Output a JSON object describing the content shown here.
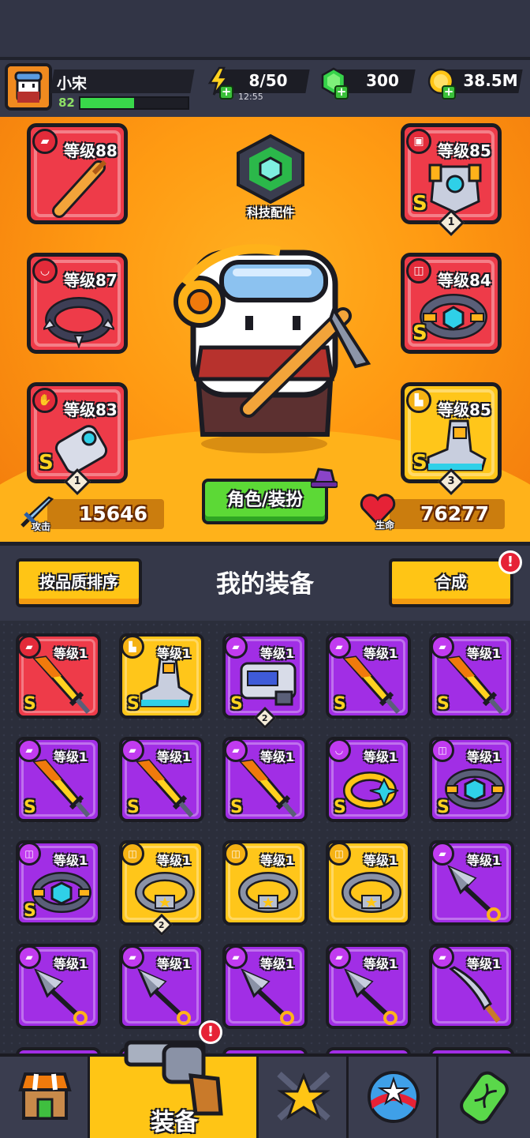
{
  "player": {
    "name": "小宋",
    "level": "82",
    "xp_fraction": 0.5
  },
  "resources": {
    "energy": {
      "value": "8/50",
      "timer": "12:55",
      "icon": "lightning-icon"
    },
    "gems": {
      "value": "300",
      "icon": "green-gem-icon"
    },
    "coins": {
      "value": "38.5M",
      "icon": "gold-coin-icon"
    }
  },
  "equipped": {
    "weapon": {
      "level": "等级88"
    },
    "armor": {
      "level": "等级85",
      "count": "1"
    },
    "necklace": {
      "level": "等级87"
    },
    "belt": {
      "level": "等级84"
    },
    "gloves": {
      "level": "等级83",
      "count": "1"
    },
    "boots": {
      "level": "等级85",
      "count": "3"
    }
  },
  "tech": {
    "label": "科技配件"
  },
  "role_button": "角色/装扮",
  "stats": {
    "attack_label": "攻击",
    "attack": "15646",
    "hp_label": "生命",
    "hp": "76277"
  },
  "equipment": {
    "title": "我的装备",
    "sort_label": "按品质排序",
    "merge_label": "合成",
    "alert": "!"
  },
  "items": [
    {
      "level": "等级1",
      "rarity": "red",
      "kind": "sword",
      "s": "S"
    },
    {
      "level": "等级1",
      "rarity": "yellow",
      "kind": "boot",
      "s": "S"
    },
    {
      "level": "等级1",
      "rarity": "purple",
      "kind": "armor",
      "s": "S",
      "count": "2"
    },
    {
      "level": "等级1",
      "rarity": "purple",
      "kind": "sword",
      "s": "S"
    },
    {
      "level": "等级1",
      "rarity": "purple",
      "kind": "sword",
      "s": "S"
    },
    {
      "level": "等级1",
      "rarity": "purple",
      "kind": "sword",
      "s": "S"
    },
    {
      "level": "等级1",
      "rarity": "purple",
      "kind": "sword",
      "s": "S"
    },
    {
      "level": "等级1",
      "rarity": "purple",
      "kind": "sword",
      "s": "S"
    },
    {
      "level": "等级1",
      "rarity": "purple",
      "kind": "ring",
      "s": "S"
    },
    {
      "level": "等级1",
      "rarity": "purple",
      "kind": "belt",
      "s": "S"
    },
    {
      "level": "等级1",
      "rarity": "purple",
      "kind": "belt",
      "s": "S"
    },
    {
      "level": "等级1",
      "rarity": "yellow",
      "kind": "starbelt",
      "count": "2"
    },
    {
      "level": "等级1",
      "rarity": "yellow",
      "kind": "starbelt"
    },
    {
      "level": "等级1",
      "rarity": "yellow",
      "kind": "starbelt"
    },
    {
      "level": "等级1",
      "rarity": "purple",
      "kind": "kunai"
    },
    {
      "level": "等级1",
      "rarity": "purple",
      "kind": "kunai"
    },
    {
      "level": "等级1",
      "rarity": "purple",
      "kind": "kunai"
    },
    {
      "level": "等级1",
      "rarity": "purple",
      "kind": "kunai"
    },
    {
      "level": "等级1",
      "rarity": "purple",
      "kind": "kunai"
    },
    {
      "level": "等级1",
      "rarity": "purple",
      "kind": "machete"
    }
  ],
  "nav": {
    "active_label": "装备",
    "alert": "!"
  },
  "colors": {
    "orange_bg": "#ff9a12",
    "purple": "#a12ee5",
    "red": "#ee3b49",
    "yellow": "#ffc61a",
    "green_button": "#5cd936"
  }
}
